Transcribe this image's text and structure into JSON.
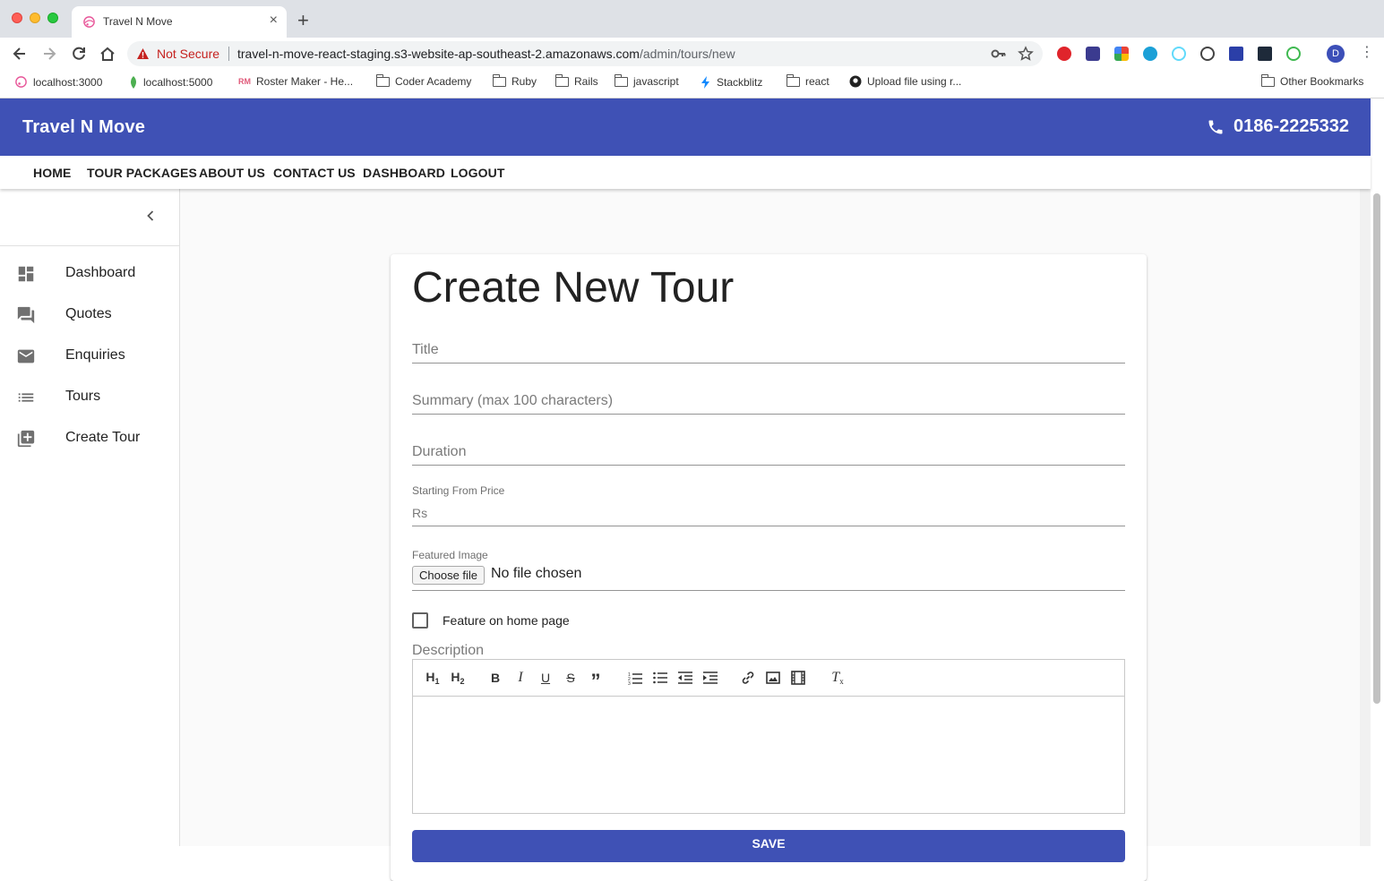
{
  "browser": {
    "tab_title": "Travel N Move",
    "security_label": "Not Secure",
    "url_host": "travel-n-move-react-staging.s3-website-ap-southeast-2.amazonaws.com",
    "url_path": "/admin/tours/new",
    "profile_initial": "D",
    "bookmarks": [
      {
        "label": "localhost:3000",
        "icon": "pink-logo-icon"
      },
      {
        "label": "localhost:5000",
        "icon": "leaf-icon"
      },
      {
        "label": "Roster Maker - He...",
        "icon": "rm-logo-icon"
      },
      {
        "label": "Coder Academy",
        "icon": "folder-icon"
      },
      {
        "label": "Ruby",
        "icon": "folder-icon"
      },
      {
        "label": "Rails",
        "icon": "folder-icon"
      },
      {
        "label": "javascript",
        "icon": "folder-icon"
      },
      {
        "label": "Stackblitz",
        "icon": "bolt-icon"
      },
      {
        "label": "react",
        "icon": "folder-icon"
      },
      {
        "label": "Upload file using r...",
        "icon": "github-icon"
      }
    ],
    "other_bookmarks": "Other Bookmarks"
  },
  "app": {
    "brand": "Travel N Move",
    "phone": "0186-2225332",
    "menu": [
      "HOME",
      "TOUR PACKAGES",
      "ABOUT US",
      "CONTACT US",
      "DASHBOARD",
      "LOGOUT"
    ],
    "sidebar": [
      {
        "label": "Dashboard",
        "icon": "dashboard-icon"
      },
      {
        "label": "Quotes",
        "icon": "forum-icon"
      },
      {
        "label": "Enquiries",
        "icon": "mail-icon"
      },
      {
        "label": "Tours",
        "icon": "list-icon"
      },
      {
        "label": "Create Tour",
        "icon": "library-add-icon"
      }
    ]
  },
  "form": {
    "heading": "Create New Tour",
    "title_placeholder": "Title",
    "summary_placeholder": "Summary (max 100 characters)",
    "duration_placeholder": "Duration",
    "price_label": "Starting From Price",
    "price_prefix": "Rs",
    "image_label": "Featured Image",
    "choose_file": "Choose file",
    "no_file": "No file chosen",
    "feature_checkbox_label": "Feature on home page",
    "feature_checked": false,
    "description_label": "Description",
    "editor_toolbar": {
      "h1": "H1",
      "h2": "H2",
      "bold": "B",
      "italic": "I",
      "underline": "U",
      "strike": "S",
      "quote": "”",
      "clear": "T"
    },
    "save_label": "SAVE"
  },
  "colors": {
    "primary": "#3f51b5",
    "not_secure": "#c5221f"
  }
}
